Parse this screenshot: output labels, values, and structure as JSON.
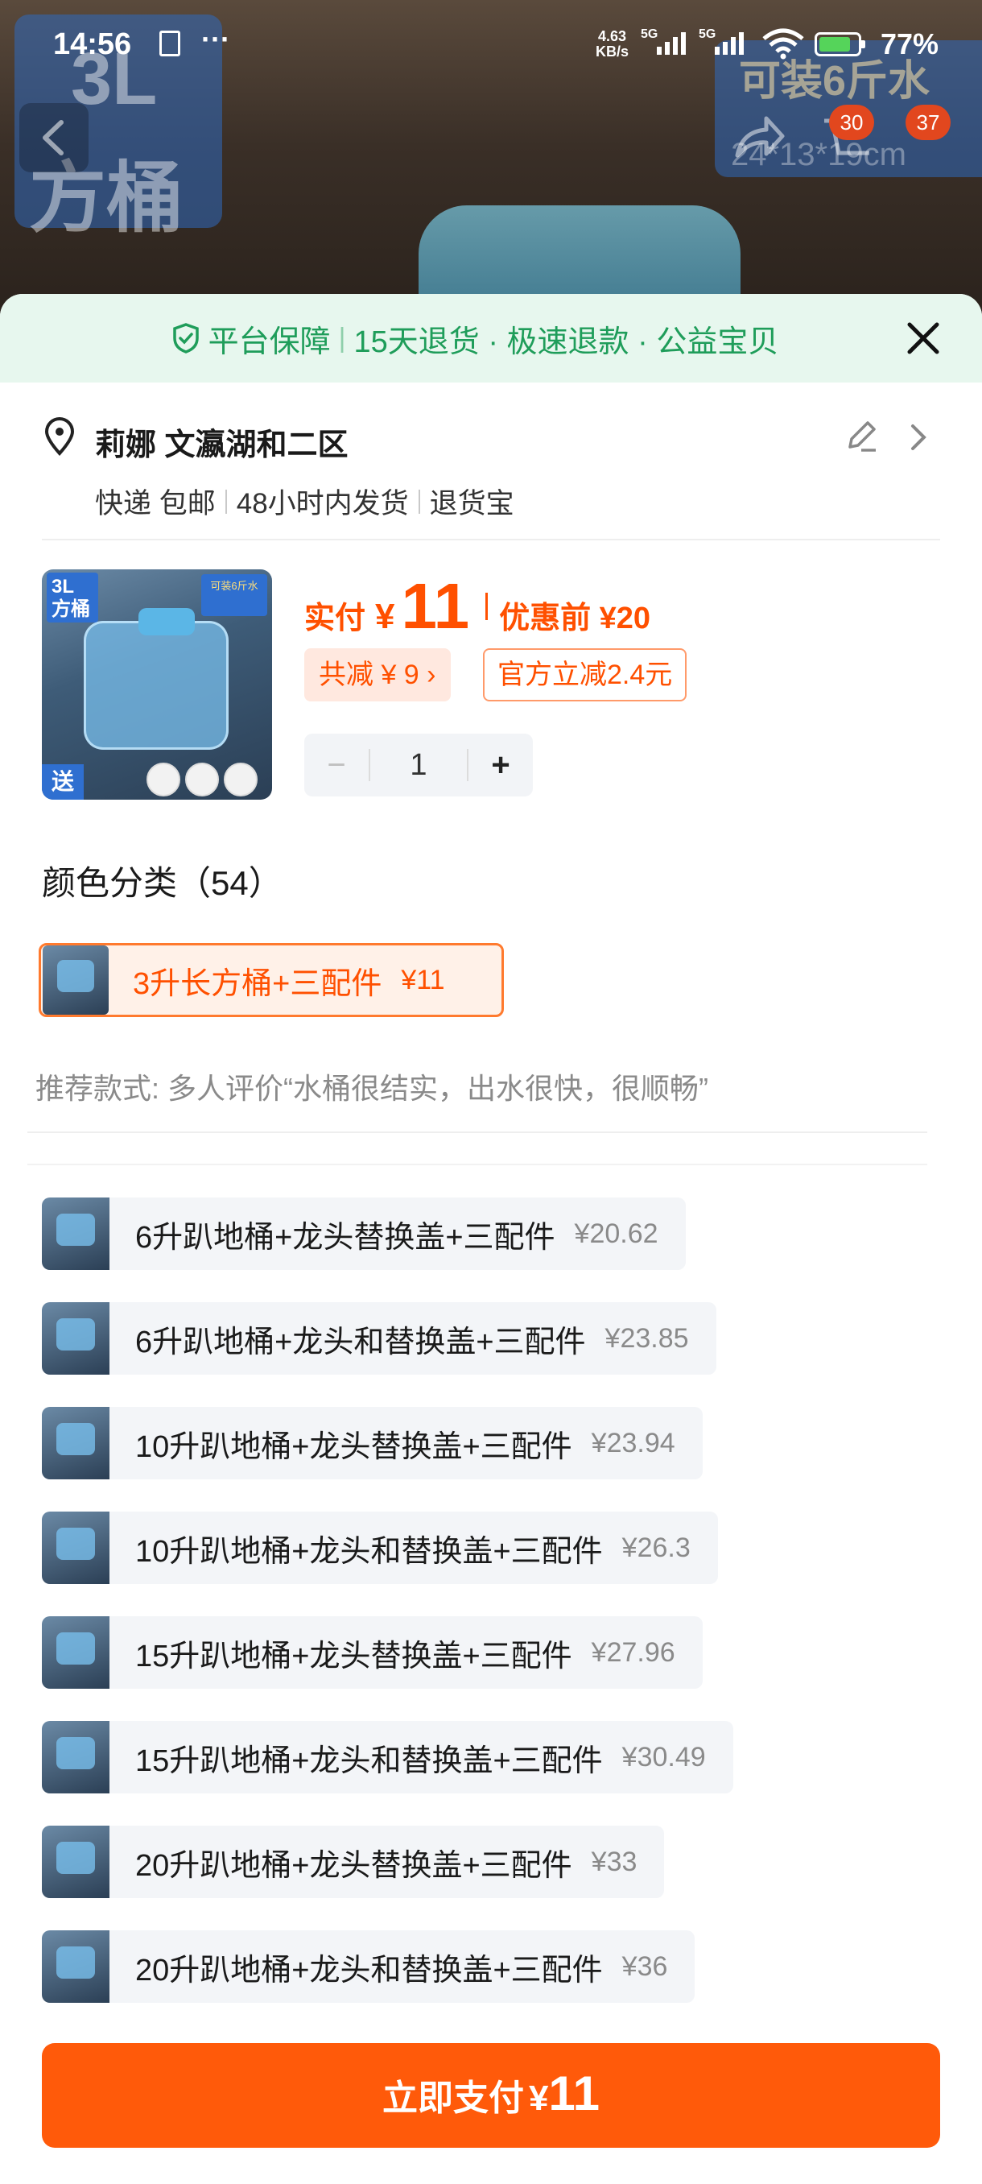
{
  "status_bar": {
    "time": "14:56",
    "net_speed_value": "4.63",
    "net_speed_unit": "KB/s",
    "net1": "5G",
    "net2": "5G",
    "battery": "77%"
  },
  "hero": {
    "label_size": "3L",
    "label_type": "方桶",
    "label_right_top": "可装6斤水",
    "label_right_bottom": "24*13*19cm",
    "cart_badge": "30",
    "more_badge": "37"
  },
  "guarantee": {
    "title": "平台保障",
    "items": "15天退货 · 极速退款 · 公益宝贝"
  },
  "address": {
    "name": "莉娜 文瀛湖和二区",
    "shipping": [
      "快递 包邮",
      "48小时内发货",
      "退货宝"
    ]
  },
  "product": {
    "thumb_size": "3L",
    "thumb_type": "方桶",
    "thumb_badge": "可装6斤水",
    "thumb_gift": "送",
    "pay_label": "实付",
    "currency": "¥",
    "pay_amount": "11",
    "before_label": "优惠前 ¥20",
    "discount_total": "共减 ¥ 9",
    "official_discount": "官方立减2.4元",
    "quantity": "1",
    "minus": "−",
    "plus": "+"
  },
  "variants": {
    "title": "颜色分类（54）",
    "selected": {
      "label": "3升长方桶+三配件",
      "price": "¥11"
    },
    "recommend": "推荐款式: 多人评价“水桶很结实，出水很快，很顺畅”",
    "options": [
      {
        "label": "6升趴地桶+龙头替换盖+三配件",
        "price": "¥20.62"
      },
      {
        "label": "6升趴地桶+龙头和替换盖+三配件",
        "price": "¥23.85"
      },
      {
        "label": "10升趴地桶+龙头替换盖+三配件",
        "price": "¥23.94"
      },
      {
        "label": "10升趴地桶+龙头和替换盖+三配件",
        "price": "¥26.3"
      },
      {
        "label": "15升趴地桶+龙头替换盖+三配件",
        "price": "¥27.96"
      },
      {
        "label": "15升趴地桶+龙头和替换盖+三配件",
        "price": "¥30.49"
      },
      {
        "label": "20升趴地桶+龙头替换盖+三配件",
        "price": "¥33"
      },
      {
        "label": "20升趴地桶+龙头和替换盖+三配件",
        "price": "¥36"
      }
    ]
  },
  "pay_button": {
    "label": "立即支付",
    "currency": "¥",
    "amount": "11"
  },
  "colors": {
    "accent": "#ff5000",
    "guarantee_green": "#1f9d5a",
    "pay_button": "#ff5a0a"
  }
}
